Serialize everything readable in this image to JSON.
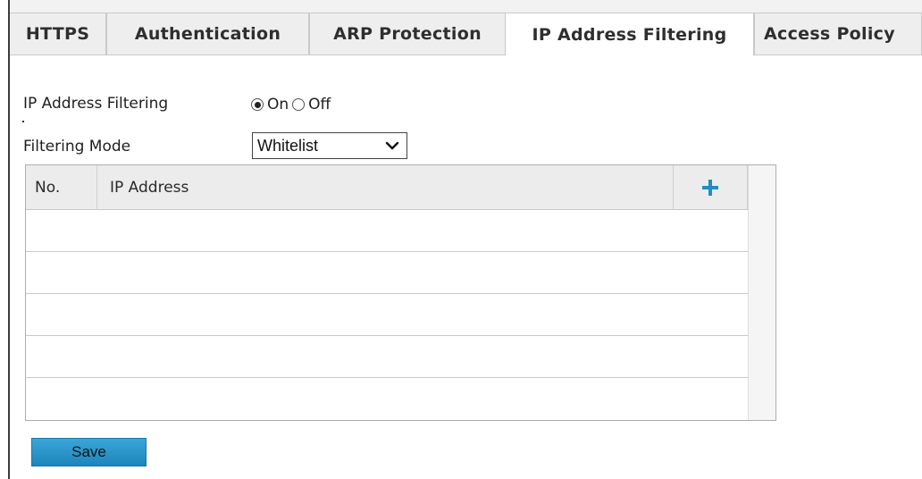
{
  "tabs": [
    {
      "label": "HTTPS",
      "active": false
    },
    {
      "label": "Authentication",
      "active": false
    },
    {
      "label": "ARP Protection",
      "active": false
    },
    {
      "label": "IP Address Filtering",
      "active": true
    },
    {
      "label": "Access Policy",
      "active": false
    }
  ],
  "filtering": {
    "label": "IP Address Filtering",
    "on_label": "On",
    "off_label": "Off",
    "selected": "On"
  },
  "mode": {
    "label": "Filtering Mode",
    "value": "Whitelist"
  },
  "table": {
    "columns": [
      "No.",
      "IP Address"
    ],
    "add_icon": "plus-icon",
    "rows": []
  },
  "actions": {
    "save_label": "Save"
  },
  "colors": {
    "accent": "#1f8fc2",
    "button": "#2a97cb"
  }
}
